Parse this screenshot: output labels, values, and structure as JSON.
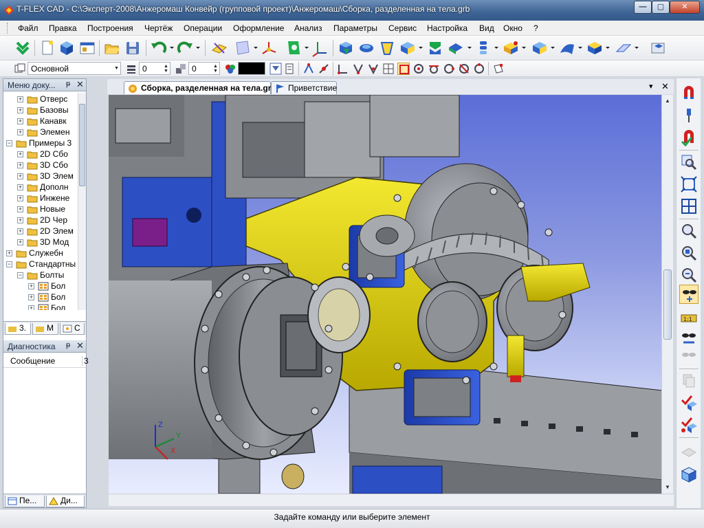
{
  "window": {
    "title": "T-FLEX CAD - С:\\Эксперт-2008\\Анжеромаш Конвейр (групповой проект)\\Анжеромаш\\Сборка, разделенная на тела.grb",
    "min_label": "—",
    "max_label": "▢",
    "close_label": "✕"
  },
  "menu": [
    "Файл",
    "Правка",
    "Построения",
    "Чертёж",
    "Операции",
    "Оформление",
    "Анализ",
    "Параметры",
    "Сервис",
    "Настройка",
    "Вид",
    "Окно",
    "?"
  ],
  "toolbar2": {
    "layer_value": "Основной",
    "level_value": "0",
    "priority_value": "0",
    "color_value": "#000000"
  },
  "left_panel": {
    "title": "Меню доку...",
    "pin": "ᵽ",
    "close": "✕",
    "tree": [
      {
        "label": "Отверс",
        "indent": 2,
        "expand": "+"
      },
      {
        "label": "Базовы",
        "indent": 2,
        "expand": "+"
      },
      {
        "label": "Канавк",
        "indent": 2,
        "expand": "+"
      },
      {
        "label": "Элемен",
        "indent": 2,
        "expand": "+"
      },
      {
        "label": "Примеры 3",
        "indent": 1,
        "expand": "−"
      },
      {
        "label": "2D Сбо",
        "indent": 2,
        "expand": "+"
      },
      {
        "label": "3D Сбо",
        "indent": 2,
        "expand": "+"
      },
      {
        "label": "3D Элем",
        "indent": 2,
        "expand": "+"
      },
      {
        "label": "Дополн",
        "indent": 2,
        "expand": "+"
      },
      {
        "label": "Инжене",
        "indent": 2,
        "expand": "+"
      },
      {
        "label": "Новые",
        "indent": 2,
        "expand": "+"
      },
      {
        "label": "2D Чер",
        "indent": 2,
        "expand": "+"
      },
      {
        "label": "2D Элем",
        "indent": 2,
        "expand": "+"
      },
      {
        "label": "3D Мод",
        "indent": 2,
        "expand": "+"
      },
      {
        "label": "Служебн",
        "indent": 1,
        "expand": "+"
      },
      {
        "label": "Стандартны",
        "indent": 1,
        "expand": "−"
      },
      {
        "label": "Болты",
        "indent": 2,
        "expand": "−"
      },
      {
        "label": "Бол",
        "indent": 3,
        "expand": "+"
      },
      {
        "label": "Бол",
        "indent": 3,
        "expand": "+"
      },
      {
        "label": "Бол",
        "indent": 3,
        "expand": "+"
      }
    ],
    "tabs": [
      "3.",
      "M",
      "C"
    ]
  },
  "diag_panel": {
    "title": "Диагностика",
    "col_header": "Сообщение",
    "col2_header": "3"
  },
  "bottom_tabs": [
    "Пе...",
    "Ди..."
  ],
  "doc_tabs": [
    {
      "label": "Сборка, разделенная на тела.grb",
      "active": true
    },
    {
      "label": "Приветствие",
      "active": false
    }
  ],
  "doc_tab_controls": {
    "arrow": "▾",
    "close": "✕"
  },
  "axes": {
    "x": "X",
    "y": "Y",
    "z": "Z"
  },
  "status": "Задайте команду или выберите элемент",
  "colors": {
    "yellow_part": "#e8dc10",
    "blue_part": "#2d4fc4",
    "steel": "#8a8d92",
    "purple_part": "#7a1f8a"
  }
}
